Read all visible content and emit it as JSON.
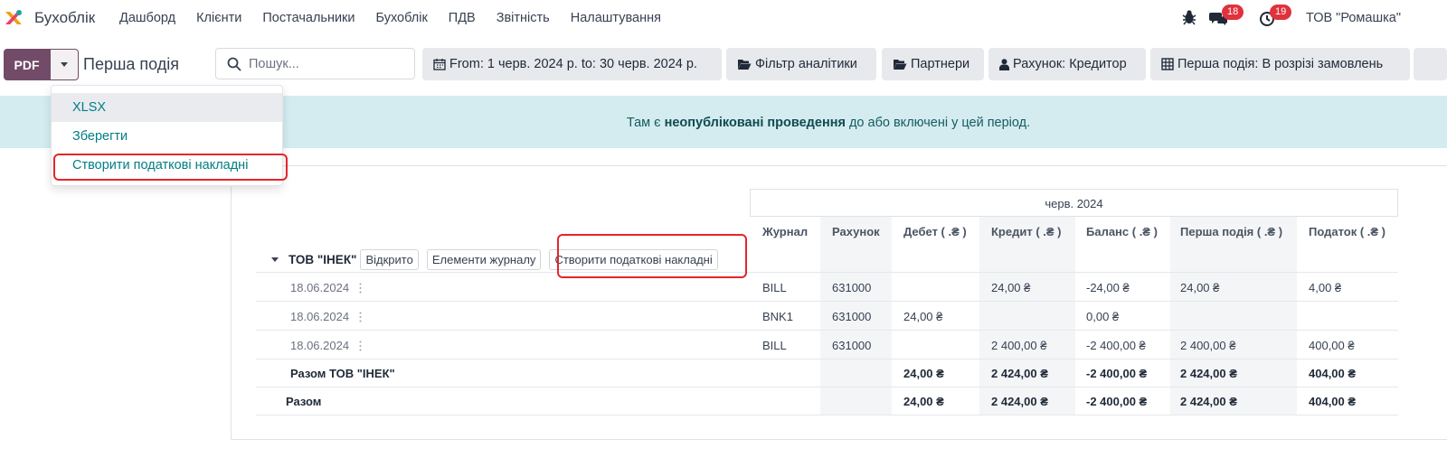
{
  "navbar": {
    "app_name": "Бухоблік",
    "menu": [
      "Дашборд",
      "Клієнти",
      "Постачальники",
      "Бухоблік",
      "ПДВ",
      "Звітність",
      "Налаштування"
    ],
    "messages_count": "18",
    "activities_count": "19",
    "company": "ТОВ \"Ромашка\""
  },
  "control_panel": {
    "pdf_label": "PDF",
    "report_title": "Перша подія",
    "search_placeholder": "Пошук...",
    "filters": [
      "From: 1 черв. 2024 р. to: 30 черв. 2024 р.",
      "Фільтр аналітики",
      "Партнери",
      "Рахунок: Кредитор",
      "Перша подія: В розрізі замовлень"
    ]
  },
  "dropdown": {
    "items": [
      "XLSX",
      "Зберегти",
      "Створити податкові накладні"
    ]
  },
  "alert": {
    "prefix": "Там є ",
    "bold": "неопубліковані проведення",
    "suffix": " до або включені у цей період."
  },
  "report": {
    "period": "черв. 2024",
    "columns": [
      "Журнал",
      "Рахунок",
      "Дебет ( .₴ )",
      "Кредит ( .₴ )",
      "Баланс ( .₴ )",
      "Перша подія ( .₴ )",
      "Податок ( .₴ )"
    ],
    "partner": {
      "name": "ТОВ \"ІНЕК\"",
      "buttons": [
        "Відкрито",
        "Елементи журналу",
        "Створити податкові накладні"
      ]
    },
    "rows": [
      {
        "date": "18.06.2024",
        "journal": "BILL",
        "account": "631000",
        "debit": "",
        "credit": "24,00 ₴",
        "balance": "-24,00 ₴",
        "first_event": "24,00 ₴",
        "tax": "4,00 ₴"
      },
      {
        "date": "18.06.2024",
        "journal": "BNK1",
        "account": "631000",
        "debit": "24,00 ₴",
        "credit": "",
        "balance": "0,00 ₴",
        "first_event": "",
        "tax": ""
      },
      {
        "date": "18.06.2024",
        "journal": "BILL",
        "account": "631000",
        "debit": "",
        "credit": "2 400,00 ₴",
        "balance": "-2 400,00 ₴",
        "first_event": "2 400,00 ₴",
        "tax": "400,00 ₴"
      }
    ],
    "partner_total": {
      "label": "Разом ТОВ \"ІНЕК\"",
      "debit": "24,00 ₴",
      "credit": "2 424,00 ₴",
      "balance": "-2 400,00 ₴",
      "first_event": "2 424,00 ₴",
      "tax": "404,00 ₴"
    },
    "grand_total": {
      "label": "Разом",
      "debit": "24,00 ₴",
      "credit": "2 424,00 ₴",
      "balance": "-2 400,00 ₴",
      "first_event": "2 424,00 ₴",
      "tax": "404,00 ₴"
    }
  },
  "colors": {
    "primary": "#714b67",
    "link": "#017e84",
    "alert_bg": "#d4ecef",
    "badge": "#e0323c",
    "highlight": "#e3262e"
  }
}
